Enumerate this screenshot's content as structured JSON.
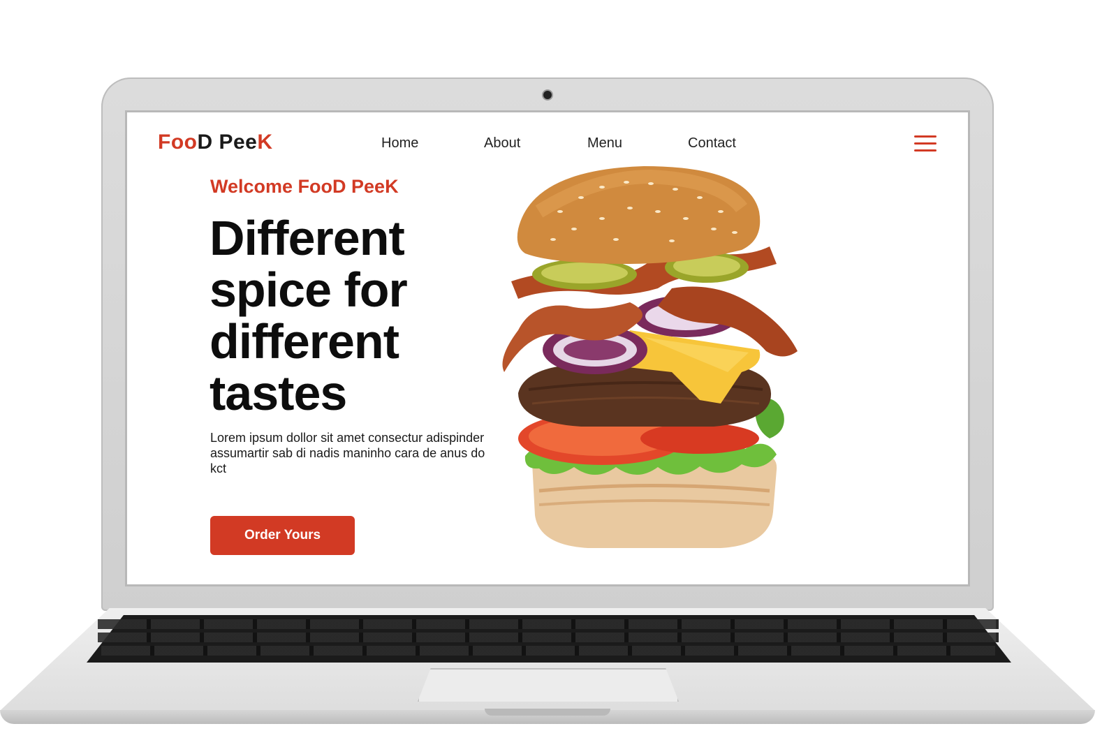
{
  "site": {
    "logo_part1": "Foo",
    "logo_part2": "D Pee",
    "logo_part3": "K"
  },
  "nav": {
    "items": [
      "Home",
      "About",
      "Menu",
      "Contact"
    ]
  },
  "hero": {
    "welcome": "Welcome FooD PeeK",
    "headline": "Different spice for different tastes",
    "description": "Lorem ipsum dollor sit amet consectur adispinder assumartir sab di nadis maninho cara de anus do kct",
    "cta_label": "Order Yours"
  },
  "colors": {
    "accent": "#d23a24",
    "text": "#0d0d0d"
  },
  "icons": {
    "menu": "hamburger-menu-icon",
    "hero_image": "burger-image"
  }
}
